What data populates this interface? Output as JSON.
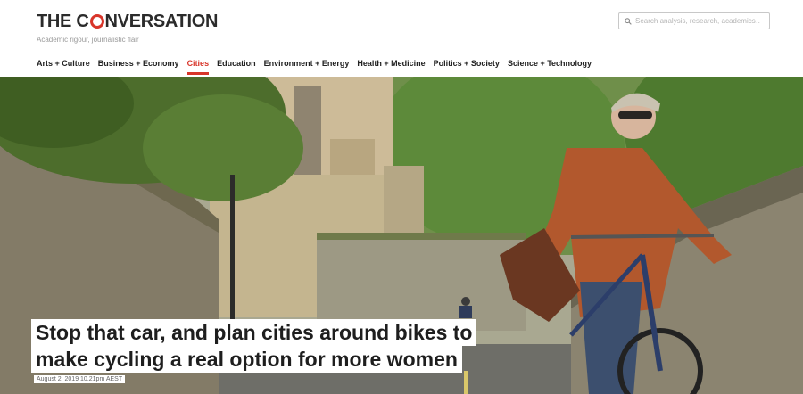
{
  "brand": {
    "logo_left": "THE C",
    "logo_right": "NVERSATION",
    "tagline": "Academic rigour, journalistic flair",
    "accent_color": "#d8352a"
  },
  "search": {
    "placeholder": "Search analysis, research, academics…",
    "icon": "search-icon"
  },
  "nav": {
    "items": [
      {
        "label": "Arts + Culture",
        "active": false
      },
      {
        "label": "Business + Economy",
        "active": false
      },
      {
        "label": "Cities",
        "active": true
      },
      {
        "label": "Education",
        "active": false
      },
      {
        "label": "Environment + Energy",
        "active": false
      },
      {
        "label": "Health + Medicine",
        "active": false
      },
      {
        "label": "Politics + Society",
        "active": false
      },
      {
        "label": "Science + Technology",
        "active": false
      }
    ]
  },
  "article": {
    "headline_line1": "Stop that car, and plan cities around bikes to",
    "headline_line2": "make cycling a real option for more women",
    "dateline": "August 2, 2019 10.21pm AEST"
  }
}
